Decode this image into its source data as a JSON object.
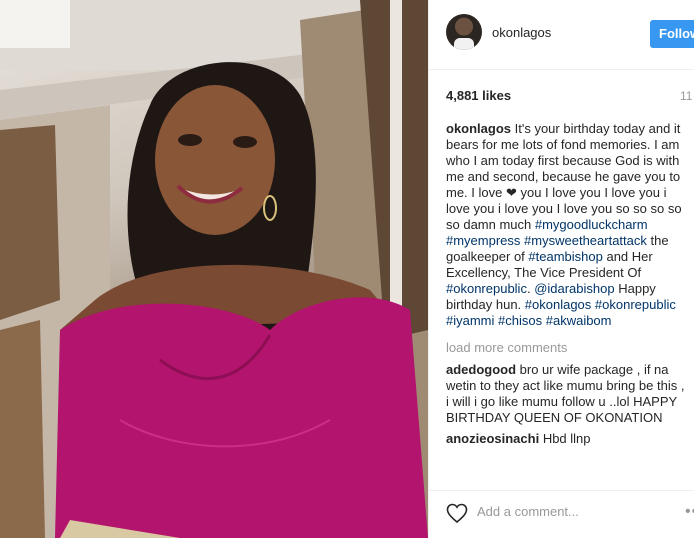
{
  "post": {
    "username": "okonlagos",
    "follow_label": "Follow",
    "likes": "4,881 likes",
    "time_ago": "11",
    "photo_icon": "portrait-photo",
    "caption": {
      "user": "okonlagos",
      "text1": " It's your birthday today and it bears for me lots of fond memories. I am who I am today first because God is with me and second, because he gave you to me. I love ",
      "heart": "❤",
      "text2": " you I love you I love you i love you i love you I love you so so so so so damn much ",
      "tag1": "#mygoodluckcharm",
      "sp1": " ",
      "tag2": "#myempress",
      "sp2": " ",
      "tag3": "#mysweetheartattack",
      "text3": " the goalkeeper of ",
      "tag4": "#teambishop",
      "text4": " and Her Excellency, The Vice President Of ",
      "tag5": "#okonrepublic",
      "text5": ". ",
      "tag6": "@idarabishop",
      "text6": " Happy birthday hun. ",
      "tag7": "#okonlagos",
      "sp3": " ",
      "tag8": "#okonrepublic",
      "sp4": " ",
      "tag9": "#iyammi",
      "sp5": " ",
      "tag10": "#chisos",
      "sp6": " ",
      "tag11": "#akwaibom"
    },
    "load_more": "load more comments",
    "comments": [
      {
        "user": "adedogood",
        "text": " bro ur wife package , if na wetin to they act like mumu bring be this , i will i go like mumu follow u ..lol HAPPY BIRTHDAY QUEEN OF OKONATION"
      },
      {
        "user": "anozieosinachi",
        "text": " Hbd llnp"
      }
    ],
    "add_comment_placeholder": "Add a comment...",
    "more_icon": "•••",
    "colors": {
      "link": "#003569",
      "follow": "#3897f0",
      "muted": "#999999"
    }
  }
}
